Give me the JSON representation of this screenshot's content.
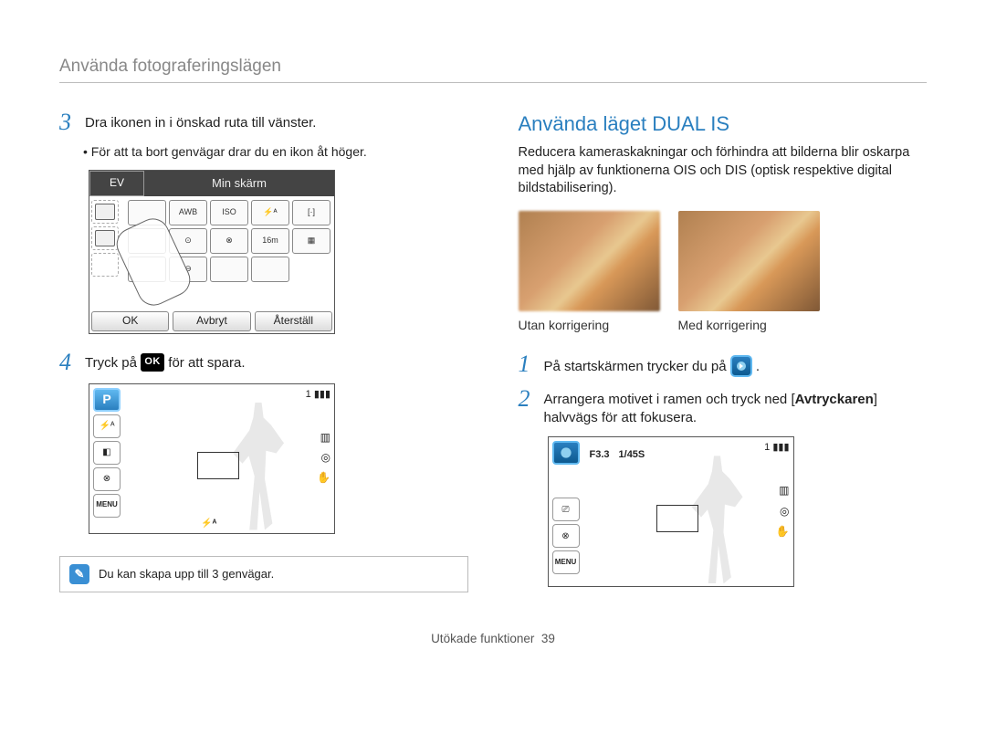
{
  "header": {
    "title": "Använda fotograferingslägen"
  },
  "left": {
    "steps": [
      {
        "num": "3",
        "text": "Dra ikonen in i önskad ruta till vänster."
      },
      {
        "num": "4",
        "text_a": "Tryck på ",
        "text_b": " för att spara."
      }
    ],
    "bullet3": "För att ta bort genvägar drar du en ikon åt höger.",
    "shot1": {
      "tab_ev": "EV",
      "tab_label": "Min skärm",
      "buttons": {
        "ok": "OK",
        "cancel": "Avbryt",
        "reset": "Återställ"
      },
      "grid_labels": [
        "",
        "AWB",
        "ISO",
        "⚡ᴬ",
        "[·]",
        "",
        "⊙",
        "⊗",
        "16m",
        "▦",
        "",
        "⊖",
        "",
        ""
      ]
    },
    "viewfinder2": {
      "left_icons": [
        "P",
        "⚡ᴬ",
        "◧",
        "⊗",
        "MENU",
        "▣"
      ],
      "top_right": "1",
      "flash_mark": "⚡ᴬ"
    },
    "note": "Du kan skapa upp till 3 genvägar.",
    "ok_icon_label": "OK"
  },
  "right": {
    "section_title": "Använda läget DUAL IS",
    "intro": "Reducera kameraskakningar och förhindra att bilderna blir oskarpa med hjälp av funktionerna OIS och DIS (optisk respektive digital bildstabilisering).",
    "captions": {
      "before": "Utan korrigering",
      "after": "Med korrigering"
    },
    "steps": [
      {
        "num": "1",
        "text_a": "På startskärmen trycker du på ",
        "text_b": " ."
      },
      {
        "num": "2",
        "text_a": "Arrangera motivet i ramen och tryck ned [",
        "bold": "Avtryckaren",
        "text_b": "] halvvägs för att fokusera."
      }
    ],
    "viewfinder3": {
      "fnum": "F3.3",
      "shutter": "1/45S",
      "top_right": "1",
      "left_icons": [
        "●",
        "⎚",
        "⊗",
        "MENU",
        "▣"
      ]
    }
  },
  "footer": {
    "label": "Utökade funktioner",
    "page": "39"
  }
}
